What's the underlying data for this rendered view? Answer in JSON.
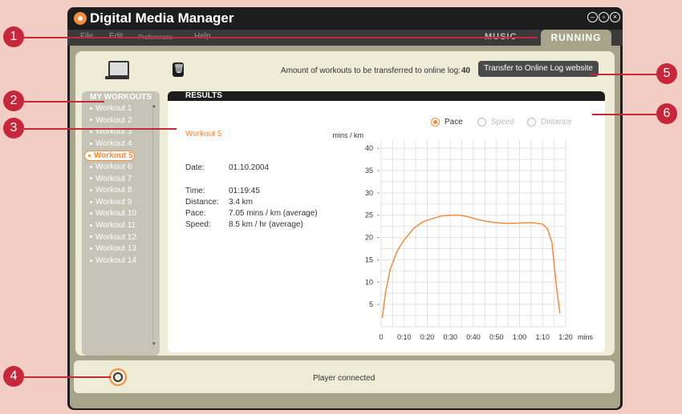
{
  "app": {
    "title": "Digital Media Manager"
  },
  "menu": [
    "File",
    "Edit",
    "Preferences",
    "Help"
  ],
  "tabs": {
    "music": "MUSIC",
    "running": "RUNNING"
  },
  "transfer": {
    "label": "Amount of workouts to be transferred to online log:",
    "count": "40",
    "button": "Transfer to Online Log website"
  },
  "sidebar": {
    "title": "MY WORKOUTS",
    "items": [
      "Workout 1",
      "Workout 2",
      "Workout 3",
      "Workout 4",
      "Workout 5",
      "Workout 6",
      "Workout 7",
      "Workout 8",
      "Workout 9",
      "Workout 10",
      "Workout 11",
      "Workout 12",
      "Workout 13",
      "Workout 14"
    ],
    "selected_index": 4
  },
  "results": {
    "header": "RESULTS",
    "workout_name": "Workout 5",
    "date_label": "Date:",
    "date": "01.10.2004",
    "time_label": "Time:",
    "time": "01:19:45",
    "distance_label": "Distance:",
    "distance": "3.4 km",
    "pace_label": "Pace:",
    "pace": "7.05 mins / km (average)",
    "speed_label": "Speed:",
    "speed": "8.5 km / hr (average)"
  },
  "radios": {
    "pace": "Pace",
    "speed": "Speed",
    "distance": "Distance",
    "selected": "pace"
  },
  "status": {
    "text": "Player connected"
  },
  "callouts": [
    "1",
    "2",
    "3",
    "4",
    "5",
    "6"
  ],
  "colors": {
    "accent": "#f58b3c",
    "callout": "#c7273a",
    "panel": "#eeecd7",
    "frame": "#a7a489"
  },
  "chart_data": {
    "type": "line",
    "ylabel": "mins / km",
    "xlabel": "mins",
    "x_ticks": [
      "0",
      "0:10",
      "0:20",
      "0:30",
      "0:40",
      "0:50",
      "1:00",
      "1:10",
      "1:20"
    ],
    "y_ticks": [
      5,
      10,
      15,
      20,
      25,
      30,
      35,
      40
    ],
    "xlim": [
      0,
      80
    ],
    "ylim": [
      0,
      42
    ],
    "grid": true,
    "series": [
      {
        "x": [
          0.5,
          2,
          4,
          7,
          10,
          14,
          18,
          22,
          26,
          30,
          34,
          38,
          42,
          46,
          50,
          54,
          58,
          62,
          66,
          70,
          72,
          74,
          75,
          76,
          77,
          77.5
        ],
        "values": [
          2,
          8,
          13,
          17,
          19.5,
          22,
          23.5,
          24.2,
          24.8,
          25,
          25,
          24.6,
          24,
          23.6,
          23.3,
          23.2,
          23.2,
          23.3,
          23.3,
          23,
          22,
          19,
          14,
          9,
          5,
          3
        ]
      }
    ]
  }
}
